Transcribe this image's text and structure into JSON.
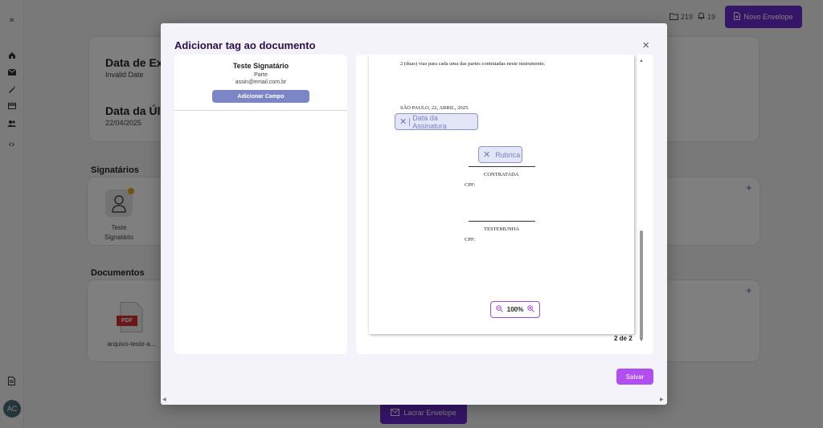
{
  "topbar": {
    "folder_count": "219",
    "bell_count": "19",
    "new_envelope_label": "Novo Envelope"
  },
  "sidebar": {
    "avatar_initials": "AC"
  },
  "background": {
    "expiration_title": "Data de Exp",
    "expiration_value": "Invalid Date",
    "last_title": "Data da Últi",
    "last_value": "22/04/2025",
    "signers_section": "Signatários",
    "signer_card_line1": "Teste",
    "signer_card_line2": "Signatário",
    "documents_section": "Documentos",
    "pdf_label": "PDF",
    "document_name": "arquivo-teste-a...",
    "plus_signers": "+",
    "plus_documents": "+",
    "seal_button_label": "Lacrar Envelope"
  },
  "modal": {
    "title": "Adicionar tag ao documento",
    "close": "×",
    "signer": {
      "name": "Teste Signatário",
      "role": "Parte",
      "email": "assin@email.com.br",
      "add_field_label": "Adicionar Campo"
    },
    "document": {
      "top_text": "2 (duas) vias para cada uma das partes contratadas neste instrumento.",
      "place_date": "SÃO PAULO, 22, ABRIL, 2025.",
      "tag_date": "Data da Assinatura",
      "tag_rubrica": "Rubrica",
      "contratada": "CONTRATADA",
      "cpf1": "CPF:",
      "testemunha": "TESTEMUNHA",
      "cpf2": "CPF:",
      "tag_remove": "✕"
    },
    "zoom_level": "100%",
    "page_count": "2 de 2",
    "save_label": "Salvar"
  }
}
